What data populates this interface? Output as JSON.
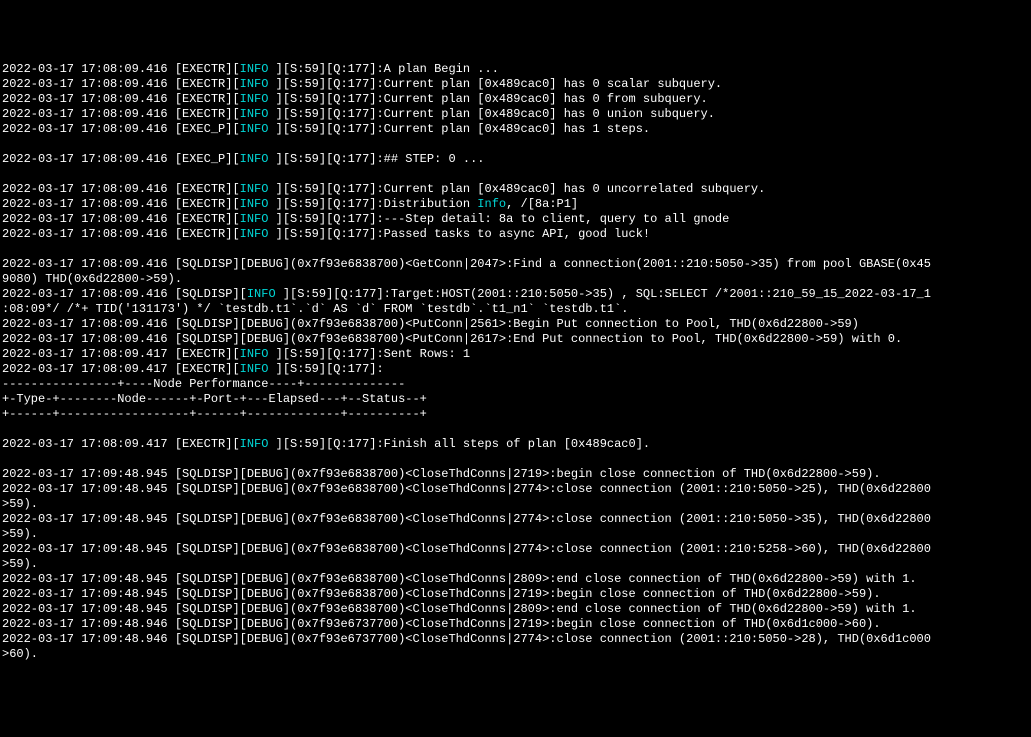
{
  "lines": [
    {
      "ts": "2022-03-17 17:08:09.416",
      "tag": "[EXECTR]",
      "level": "INFO",
      "suffix": " ][S:59][Q:177]:A plan Begin ..."
    },
    {
      "ts": "2022-03-17 17:08:09.416",
      "tag": "[EXECTR]",
      "level": "INFO",
      "suffix": " ][S:59][Q:177]:Current plan [0x489cac0] has 0 scalar subquery."
    },
    {
      "ts": "2022-03-17 17:08:09.416",
      "tag": "[EXECTR]",
      "level": "INFO",
      "suffix": " ][S:59][Q:177]:Current plan [0x489cac0] has 0 from subquery."
    },
    {
      "ts": "2022-03-17 17:08:09.416",
      "tag": "[EXECTR]",
      "level": "INFO",
      "suffix": " ][S:59][Q:177]:Current plan [0x489cac0] has 0 union subquery."
    },
    {
      "ts": "2022-03-17 17:08:09.416",
      "tag": "[EXEC_P]",
      "level": "INFO",
      "suffix": " ][S:59][Q:177]:Current plan [0x489cac0] has 1 steps."
    },
    {
      "blank": true
    },
    {
      "ts": "2022-03-17 17:08:09.416",
      "tag": "[EXEC_P]",
      "level": "INFO",
      "suffix": " ][S:59][Q:177]:## STEP: 0 ..."
    },
    {
      "blank": true
    },
    {
      "ts": "2022-03-17 17:08:09.416",
      "tag": "[EXECTR]",
      "level": "INFO",
      "suffix": " ][S:59][Q:177]:Current plan [0x489cac0] has 0 uncorrelated subquery."
    },
    {
      "ts": "2022-03-17 17:08:09.416",
      "tag": "[EXECTR]",
      "level": "INFO",
      "suffix": " ][S:59][Q:177]:Distribution ",
      "extra_info": "Info",
      "suffix2": ", /[8a:P1]"
    },
    {
      "ts": "2022-03-17 17:08:09.416",
      "tag": "[EXECTR]",
      "level": "INFO",
      "suffix": " ][S:59][Q:177]:---Step detail: 8a to client, query to all gnode"
    },
    {
      "ts": "2022-03-17 17:08:09.416",
      "tag": "[EXECTR]",
      "level": "INFO",
      "suffix": " ][S:59][Q:177]:Passed tasks to async API, good luck!"
    },
    {
      "blank": true
    },
    {
      "raw": "2022-03-17 17:08:09.416 [SQLDISP][DEBUG](0x7f93e6838700)<GetConn|2047>:Find a connection(2001::210:5050->35) from pool GBASE(0x45"
    },
    {
      "raw": "9080) THD(0x6d22800->59)."
    },
    {
      "ts": "2022-03-17 17:08:09.416",
      "tag": "[SQLDISP]",
      "level": "INFO",
      "suffix": " ][S:59][Q:177]:Target:HOST(2001::210:5050->35) , SQL:SELECT /*2001::210_59_15_2022-03-17_1"
    },
    {
      "raw": ":08:09*/ /*+ TID('131173') */ `testdb.t1`.`d` AS `d` FROM `testdb`.`t1_n1` `testdb.t1`."
    },
    {
      "raw": "2022-03-17 17:08:09.416 [SQLDISP][DEBUG](0x7f93e6838700)<PutConn|2561>:Begin Put connection to Pool, THD(0x6d22800->59)"
    },
    {
      "raw": "2022-03-17 17:08:09.416 [SQLDISP][DEBUG](0x7f93e6838700)<PutConn|2617>:End Put connection to Pool, THD(0x6d22800->59) with 0."
    },
    {
      "ts": "2022-03-17 17:08:09.417",
      "tag": "[EXECTR]",
      "level": "INFO",
      "suffix": " ][S:59][Q:177]:Sent Rows: 1"
    },
    {
      "ts": "2022-03-17 17:08:09.417",
      "tag": "[EXECTR]",
      "level": "INFO",
      "suffix": " ][S:59][Q:177]:"
    },
    {
      "raw": "----------------+----Node Performance----+--------------"
    },
    {
      "raw": "+-Type-+--------Node------+-Port-+---Elapsed---+--Status--+"
    },
    {
      "raw": "+------+------------------+------+-------------+----------+"
    },
    {
      "blank": true
    },
    {
      "ts": "2022-03-17 17:08:09.417",
      "tag": "[EXECTR]",
      "level": "INFO",
      "suffix": " ][S:59][Q:177]:Finish all steps of plan [0x489cac0]."
    },
    {
      "blank": true
    },
    {
      "raw": "2022-03-17 17:09:48.945 [SQLDISP][DEBUG](0x7f93e6838700)<CloseThdConns|2719>:begin close connection of THD(0x6d22800->59)."
    },
    {
      "raw": "2022-03-17 17:09:48.945 [SQLDISP][DEBUG](0x7f93e6838700)<CloseThdConns|2774>:close connection (2001::210:5050->25), THD(0x6d22800"
    },
    {
      "raw": ">59)."
    },
    {
      "raw": "2022-03-17 17:09:48.945 [SQLDISP][DEBUG](0x7f93e6838700)<CloseThdConns|2774>:close connection (2001::210:5050->35), THD(0x6d22800"
    },
    {
      "raw": ">59)."
    },
    {
      "raw": "2022-03-17 17:09:48.945 [SQLDISP][DEBUG](0x7f93e6838700)<CloseThdConns|2774>:close connection (2001::210:5258->60), THD(0x6d22800"
    },
    {
      "raw": ">59)."
    },
    {
      "raw": "2022-03-17 17:09:48.945 [SQLDISP][DEBUG](0x7f93e6838700)<CloseThdConns|2809>:end close connection of THD(0x6d22800->59) with 1."
    },
    {
      "raw": "2022-03-17 17:09:48.945 [SQLDISP][DEBUG](0x7f93e6838700)<CloseThdConns|2719>:begin close connection of THD(0x6d22800->59)."
    },
    {
      "raw": "2022-03-17 17:09:48.945 [SQLDISP][DEBUG](0x7f93e6838700)<CloseThdConns|2809>:end close connection of THD(0x6d22800->59) with 1."
    },
    {
      "raw": "2022-03-17 17:09:48.946 [SQLDISP][DEBUG](0x7f93e6737700)<CloseThdConns|2719>:begin close connection of THD(0x6d1c000->60)."
    },
    {
      "raw": "2022-03-17 17:09:48.946 [SQLDISP][DEBUG](0x7f93e6737700)<CloseThdConns|2774>:close connection (2001::210:5050->28), THD(0x6d1c000"
    },
    {
      "raw": ">60)."
    }
  ]
}
